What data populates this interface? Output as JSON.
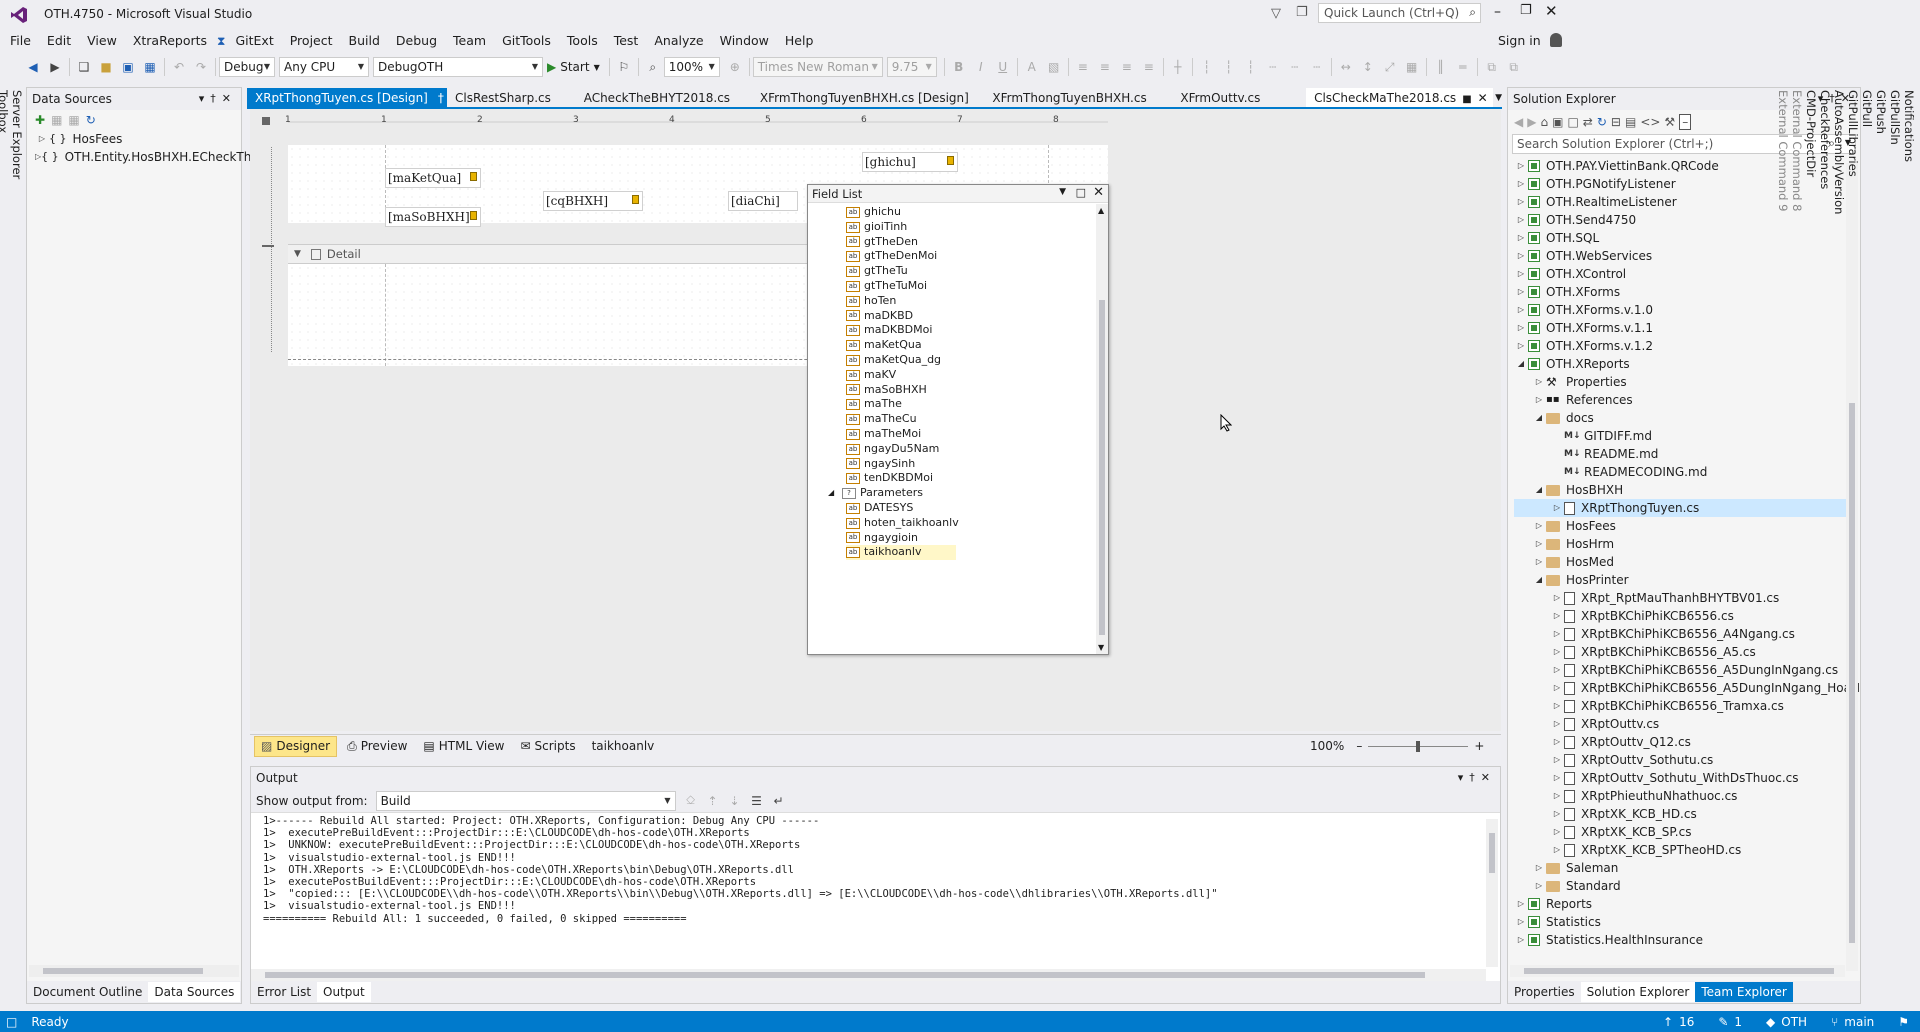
{
  "app": {
    "title": "OTH.4750 - Microsoft Visual Studio",
    "quick_launch": "Quick Launch (Ctrl+Q)",
    "sign_in": "Sign in"
  },
  "menu": [
    "File",
    "Edit",
    "View",
    "XtraReports",
    "GitExt",
    "Project",
    "Build",
    "Debug",
    "Team",
    "GitTools",
    "Tools",
    "Test",
    "Analyze",
    "Window",
    "Help"
  ],
  "toolbar": {
    "config": "Debug",
    "platform": "Any CPU",
    "startup": "DebugOTH",
    "start_label": "Start",
    "zoom": "100%",
    "font_name": "Times New Roman",
    "font_size": "9.75",
    "bold": "B",
    "italic": "I",
    "underline": "U"
  },
  "left_strip": [
    "Server Explorer",
    "Toolbox"
  ],
  "right_strip": [
    "Notifications",
    "GitPullSln",
    "GitPush",
    "GitPull",
    "GitPullLibraries",
    "AutoAssemblyVersion",
    "CheckReferences",
    "CMD-ProjectDir",
    "External Command 8",
    "External Command 9"
  ],
  "data_sources": {
    "title": "Data Sources",
    "items": [
      "HosFees",
      "OTH.Entity.HosBHXH.ECheckTh"
    ],
    "tab_outline": "Document Outline",
    "tab_sources": "Data Sources"
  },
  "doc_tabs": [
    "XRptThongTuyen.cs [Design]",
    "ClsRestSharp.cs",
    "ACheckTheBHYT2018.cs",
    "XFrmThongTuyenBHXH.cs [Design]",
    "XFrmThongTuyenBHXH.cs",
    "XFrmOuttv.cs",
    "ClsCheckMaThe2018.cs"
  ],
  "designer": {
    "controls": [
      "[maKetQua]",
      "[maSoBHXH]",
      "[cqBHXH]",
      "[diaChi]",
      "[ghichu]"
    ],
    "detail_band": "Detail",
    "ruler": [
      "1",
      "2",
      "3",
      "4",
      "5",
      "6",
      "7",
      "8"
    ],
    "bottom_tabs": {
      "designer": "Designer",
      "preview": "Preview",
      "html": "HTML View",
      "scripts": "Scripts",
      "selected": "taikhoanlv"
    },
    "zoom": "100%"
  },
  "field_list": {
    "title": "Field List",
    "fields": [
      "ghichu",
      "gioiTinh",
      "gtTheDen",
      "gtTheDenMoi",
      "gtTheTu",
      "gtTheTuMoi",
      "hoTen",
      "maDKBD",
      "maDKBDMoi",
      "maKetQua",
      "maKetQua_dg",
      "maKV",
      "maSoBHXH",
      "maThe",
      "maTheCu",
      "maTheMoi",
      "ngayDu5Nam",
      "ngaySinh",
      "tenDKBDMoi"
    ],
    "parameters_label": "Parameters",
    "parameters": [
      "DATESYS",
      "hoten_taikhoanlv",
      "ngaygioin",
      "taikhoanlv"
    ]
  },
  "output": {
    "title": "Output",
    "show_from_label": "Show output from:",
    "source": "Build",
    "lines": [
      "1>------ Rebuild All started: Project: OTH.XReports, Configuration: Debug Any CPU ------",
      "1>  executePreBuildEvent:::ProjectDir:::E:\\CLOUDCODE\\dh-hos-code\\OTH.XReports",
      "1>  UNKNOW: executePreBuildEvent:::ProjectDir:::E:\\CLOUDCODE\\dh-hos-code\\OTH.XReports",
      "1>  visualstudio-external-tool.js END!!!",
      "1>  OTH.XReports -> E:\\CLOUDCODE\\dh-hos-code\\OTH.XReports\\bin\\Debug\\OTH.XReports.dll",
      "1>  executePostBuildEvent:::ProjectDir:::E:\\CLOUDCODE\\dh-hos-code\\OTH.XReports",
      "1>  \"copied::: [E:\\\\CLOUDCODE\\\\dh-hos-code\\\\OTH.XReports\\\\bin\\\\Debug\\\\OTH.XReports.dll] => [E:\\\\CLOUDCODE\\\\dh-hos-code\\\\dhlibraries\\\\OTH.XReports.dll]\"",
      "1>  visualstudio-external-tool.js END!!!",
      "========== Rebuild All: 1 succeeded, 0 failed, 0 skipped =========="
    ],
    "tab_errors": "Error List",
    "tab_output": "Output"
  },
  "solution": {
    "title": "Solution Explorer",
    "search": "Search Solution Explorer (Ctrl+;)",
    "items": [
      {
        "t": "pj",
        "l": "OTH.PAY.ViettinBank.QRCode",
        "d": 0,
        "e": "c"
      },
      {
        "t": "pj",
        "l": "OTH.PGNotifyListener",
        "d": 0,
        "e": "c"
      },
      {
        "t": "pj",
        "l": "OTH.RealtimeListener",
        "d": 0,
        "e": "c"
      },
      {
        "t": "pj",
        "l": "OTH.Send4750",
        "d": 0,
        "e": "c"
      },
      {
        "t": "pj",
        "l": "OTH.SQL",
        "d": 0,
        "e": "c"
      },
      {
        "t": "pj",
        "l": "OTH.WebServices",
        "d": 0,
        "e": "c"
      },
      {
        "t": "pj",
        "l": "OTH.XControl",
        "d": 0,
        "e": "c"
      },
      {
        "t": "pj",
        "l": "OTH.XForms",
        "d": 0,
        "e": "c"
      },
      {
        "t": "pj",
        "l": "OTH.XForms.v.1.0",
        "d": 0,
        "e": "c"
      },
      {
        "t": "pj",
        "l": "OTH.XForms.v.1.1",
        "d": 0,
        "e": "c"
      },
      {
        "t": "pj",
        "l": "OTH.XForms.v.1.2",
        "d": 0,
        "e": "c"
      },
      {
        "t": "pj",
        "l": "OTH.XReports",
        "d": 0,
        "e": "o"
      },
      {
        "t": "pr",
        "l": "Properties",
        "d": 1,
        "e": "c"
      },
      {
        "t": "rf",
        "l": "References",
        "d": 1,
        "e": "c"
      },
      {
        "t": "fd",
        "l": "docs",
        "d": 1,
        "e": "o"
      },
      {
        "t": "md",
        "l": "GITDIFF.md",
        "d": 2,
        "e": ""
      },
      {
        "t": "md",
        "l": "README.md",
        "d": 2,
        "e": ""
      },
      {
        "t": "md",
        "l": "READMECODING.md",
        "d": 2,
        "e": ""
      },
      {
        "t": "fd",
        "l": "HosBHXH",
        "d": 1,
        "e": "o"
      },
      {
        "t": "fl",
        "l": "XRptThongTuyen.cs",
        "d": 2,
        "e": "c",
        "sel": true
      },
      {
        "t": "fd",
        "l": "HosFees",
        "d": 1,
        "e": "c"
      },
      {
        "t": "fd",
        "l": "HosHrm",
        "d": 1,
        "e": "c"
      },
      {
        "t": "fd",
        "l": "HosMed",
        "d": 1,
        "e": "c"
      },
      {
        "t": "fd",
        "l": "HosPrinter",
        "d": 1,
        "e": "o"
      },
      {
        "t": "fl",
        "l": "XRpt_RptMauThanhBHYTBV01.cs",
        "d": 2,
        "e": "c"
      },
      {
        "t": "fl",
        "l": "XRptBKChiPhiKCB6556.cs",
        "d": 2,
        "e": "c"
      },
      {
        "t": "fl",
        "l": "XRptBKChiPhiKCB6556_A4Ngang.cs",
        "d": 2,
        "e": "c"
      },
      {
        "t": "fl",
        "l": "XRptBKChiPhiKCB6556_A5.cs",
        "d": 2,
        "e": "c"
      },
      {
        "t": "fl",
        "l": "XRptBKChiPhiKCB6556_A5DungInNgang.cs",
        "d": 2,
        "e": "c"
      },
      {
        "t": "fl",
        "l": "XRptBKChiPhiKCB6556_A5DungInNgang_HoaH",
        "d": 2,
        "e": "c"
      },
      {
        "t": "fl",
        "l": "XRptBKChiPhiKCB6556_Tramxa.cs",
        "d": 2,
        "e": "c"
      },
      {
        "t": "fl",
        "l": "XRptOuttv.cs",
        "d": 2,
        "e": "c"
      },
      {
        "t": "fl",
        "l": "XRptOuttv_Q12.cs",
        "d": 2,
        "e": "c"
      },
      {
        "t": "fl",
        "l": "XRptOuttv_Sothutu.cs",
        "d": 2,
        "e": "c"
      },
      {
        "t": "fl",
        "l": "XRptOuttv_Sothutu_WithDsThuoc.cs",
        "d": 2,
        "e": "c"
      },
      {
        "t": "fl",
        "l": "XRptPhieuthuNhathuoc.cs",
        "d": 2,
        "e": "c"
      },
      {
        "t": "fl",
        "l": "XRptXK_KCB_HD.cs",
        "d": 2,
        "e": "c"
      },
      {
        "t": "fl",
        "l": "XRptXK_KCB_SP.cs",
        "d": 2,
        "e": "c"
      },
      {
        "t": "fl",
        "l": "XRptXK_KCB_SPTheoHD.cs",
        "d": 2,
        "e": "c"
      },
      {
        "t": "fd",
        "l": "Saleman",
        "d": 1,
        "e": "c"
      },
      {
        "t": "fd",
        "l": "Standard",
        "d": 1,
        "e": "c"
      },
      {
        "t": "pj",
        "l": "Reports",
        "d": 0,
        "e": "c"
      },
      {
        "t": "pj",
        "l": "Statistics",
        "d": 0,
        "e": "c"
      },
      {
        "t": "pj",
        "l": "Statistics.HealthInsurance",
        "d": 0,
        "e": "c"
      }
    ],
    "tab_properties": "Properties",
    "tab_solution": "Solution Explorer",
    "tab_team": "Team Explorer"
  },
  "status": {
    "ready": "Ready",
    "up": "16",
    "pencil": "1",
    "repo": "OTH",
    "branch": "main"
  }
}
